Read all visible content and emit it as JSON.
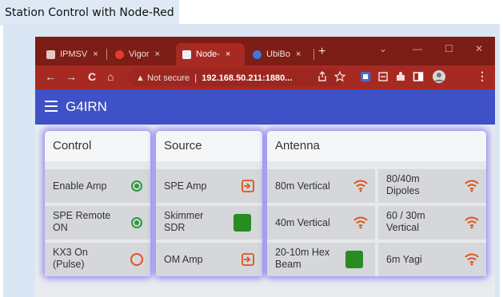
{
  "caption": "Station Control with Node-Red",
  "browser": {
    "tabs": [
      {
        "label": "IPMSV",
        "close": "×"
      },
      {
        "label": "Vigor",
        "close": "×"
      },
      {
        "label": "Node-",
        "close": "×"
      },
      {
        "label": "UbiBo",
        "close": "×"
      }
    ],
    "new_tab": "+",
    "window_controls": {
      "dropdown": "⌄",
      "minimize": "—",
      "maximize": "☐",
      "close": "✕"
    },
    "nav": {
      "back": "←",
      "forward": "→",
      "reload": "C",
      "home": "⌂"
    },
    "security": "Not secure",
    "url": "192.168.50.211:1880...",
    "colors": {
      "tabbar": "#7c1d16",
      "toolbar": "#a72a22"
    }
  },
  "app": {
    "title": "G4IRN",
    "header_color": "#3f51c6"
  },
  "groups": {
    "control": {
      "title": "Control",
      "items": [
        {
          "label": "Enable Amp",
          "indicator": "radio-on"
        },
        {
          "label": "SPE Remote ON",
          "indicator": "radio-on"
        },
        {
          "label": "KX3 On (Pulse)",
          "indicator": "radio-off"
        }
      ]
    },
    "source": {
      "title": "Source",
      "items": [
        {
          "label": "SPE Amp",
          "indicator": "input-icon"
        },
        {
          "label": "Skimmer SDR",
          "indicator": "green-square"
        },
        {
          "label": "OM Amp",
          "indicator": "input-icon"
        }
      ]
    },
    "antenna": {
      "title": "Antenna",
      "items": [
        {
          "label": "80m Vertical",
          "indicator": "wifi-icon"
        },
        {
          "label": "80/40m Dipoles",
          "indicator": "wifi-icon"
        },
        {
          "label": "40m Vertical",
          "indicator": "wifi-icon"
        },
        {
          "label": "60 / 30m Vertical",
          "indicator": "wifi-icon"
        },
        {
          "label": "20-10m Hex Beam",
          "indicator": "green-square"
        },
        {
          "label": "6m Yagi",
          "indicator": "wifi-icon"
        }
      ]
    }
  }
}
